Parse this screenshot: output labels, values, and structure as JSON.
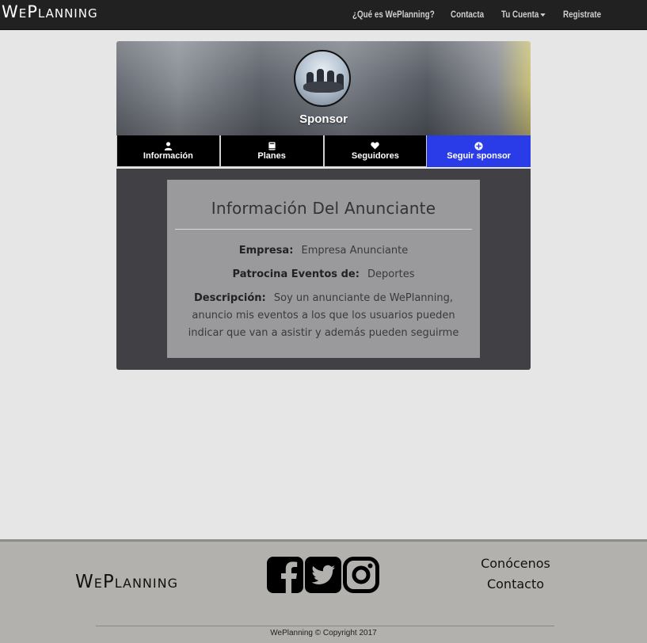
{
  "navbar": {
    "brand": "WePlanning",
    "links": {
      "about": "¿Qué es WePlanning?",
      "contact": "Contacta",
      "account": "Tu Cuenta",
      "register": "Registrate"
    }
  },
  "profile": {
    "role_title": "Sponsor",
    "tabs": {
      "info": "Información",
      "plans": "Planes",
      "followers": "Seguidores",
      "follow": "Seguir sponsor"
    }
  },
  "info_card": {
    "title": "Información Del Anunciante",
    "company_label": "Empresa:",
    "company_value": "Empresa Anunciante",
    "sponsors_label": "Patrocina Eventos de:",
    "sponsors_value": "Deportes",
    "description_label": "Descripción:",
    "description_value": "Soy un anunciante de WePlanning, anuncio mis eventos a los que los usuarios pueden indicar que van a asistir y además pueden seguirme"
  },
  "footer": {
    "brand": "WePlanning",
    "links": {
      "about": "Conócenos",
      "contact": "Contacto"
    },
    "copyright": "WePlanning © Copyright 2017",
    "social": [
      "facebook-icon",
      "twitter-icon",
      "instagram-icon"
    ]
  },
  "colors": {
    "navbar_bg": "#212121",
    "active_tab": "#2a3be8",
    "panel_bg": "#404045",
    "card_bg": "#9a9a9c",
    "footer_bg": "#b3b1ae"
  }
}
